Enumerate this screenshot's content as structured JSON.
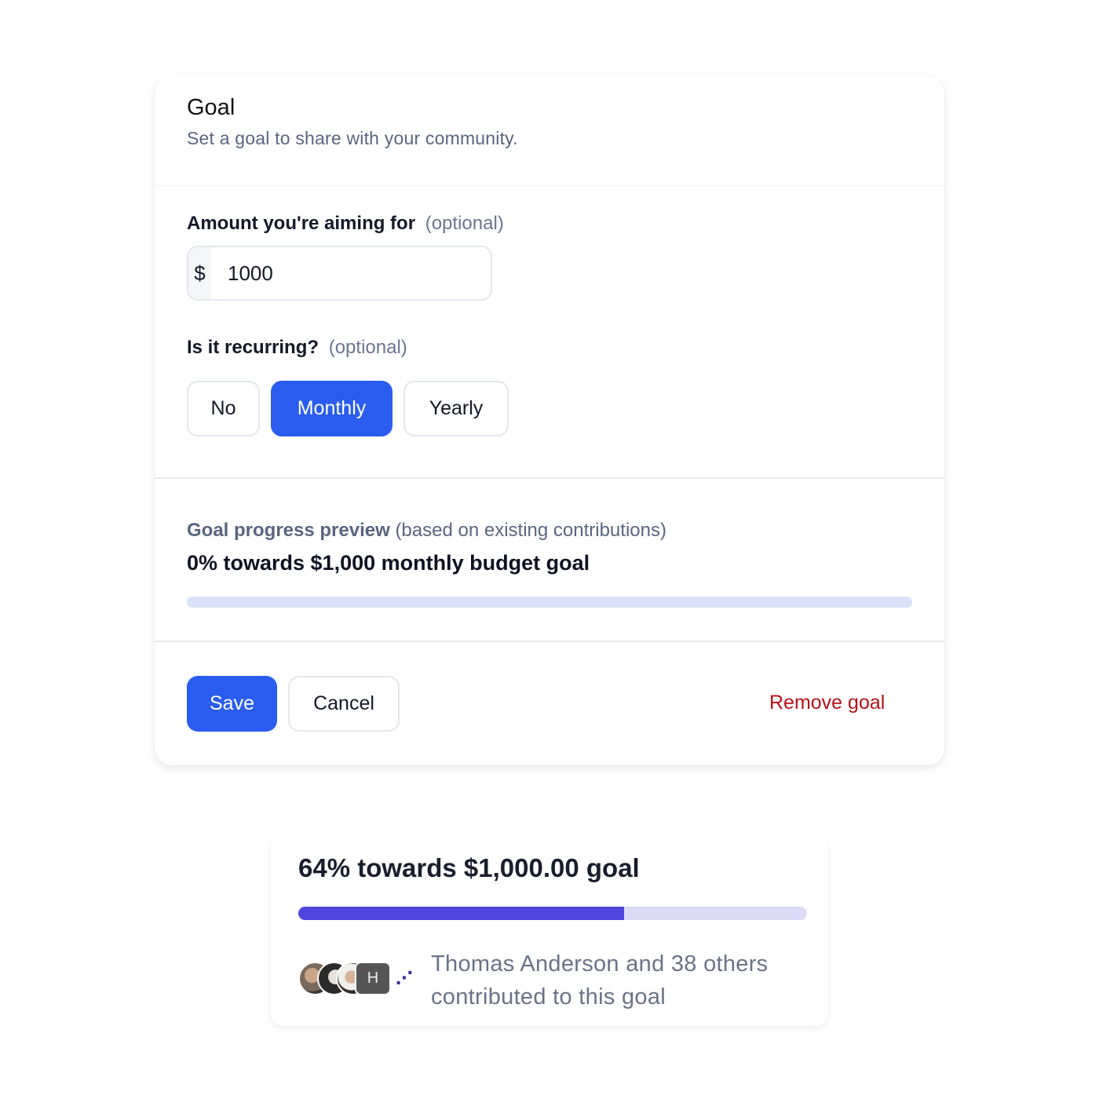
{
  "goal_form": {
    "title": "Goal",
    "subtitle": "Set a goal to share with your community.",
    "amount": {
      "label": "Amount you're aiming for",
      "optional": "(optional)",
      "prefix": "$",
      "value": "1000"
    },
    "recurring": {
      "label": "Is it recurring?",
      "optional": "(optional)",
      "options": [
        "No",
        "Monthly",
        "Yearly"
      ],
      "selected": "Monthly"
    },
    "preview": {
      "label": "Goal progress preview",
      "note": "(based on existing contributions)",
      "headline": "0% towards $1,000 monthly budget goal",
      "progress_percent": 0
    },
    "actions": {
      "save": "Save",
      "cancel": "Cancel",
      "remove": "Remove goal"
    }
  },
  "goal_widget": {
    "headline": "64% towards $1,000.00 goal",
    "progress_percent": 64,
    "avatar_initial": "H",
    "more_icon": "ellipsis-icon",
    "caption": "Thomas Anderson and 38 others contributed to this goal"
  },
  "colors": {
    "primary": "#2b5cf0",
    "danger": "#b4121a",
    "widget_fill": "#4f46e0",
    "widget_track": "#dcdaf7",
    "preview_track": "#d9e1fb"
  }
}
